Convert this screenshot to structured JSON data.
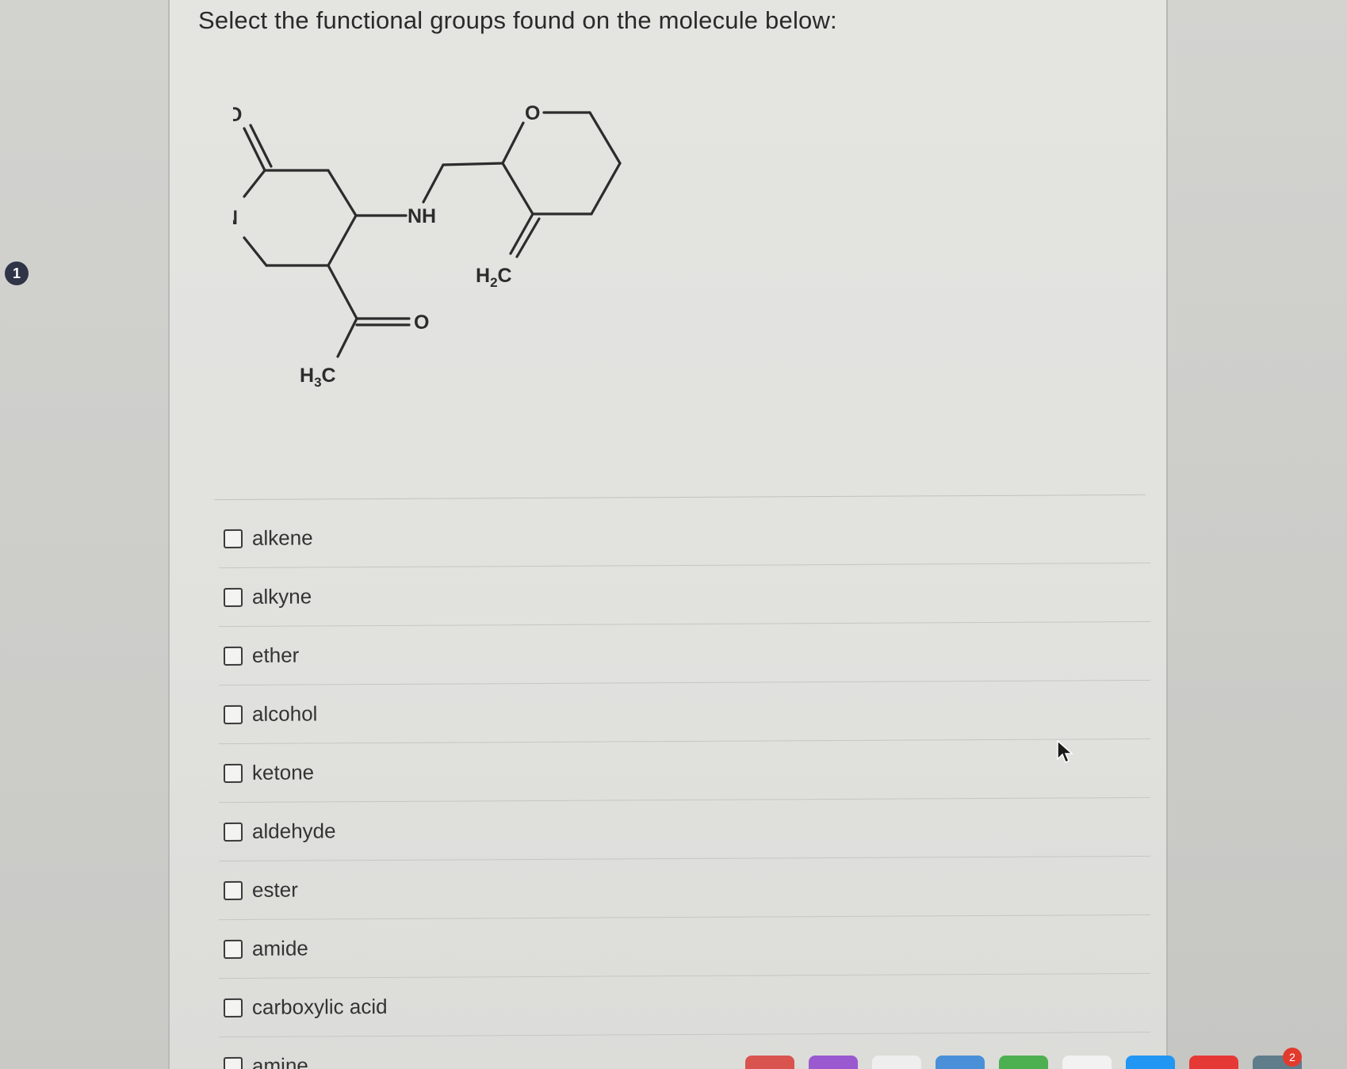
{
  "question": {
    "number": "1",
    "prompt": "Select the functional groups found on the molecule below:"
  },
  "molecule": {
    "labels": {
      "o_lactam": "O",
      "hn": "HN",
      "nh": "NH",
      "o_ring": "O",
      "o_ketone": "O",
      "h3c": "H3C",
      "h2c": "H2C"
    }
  },
  "options": [
    {
      "label": "alkene",
      "checked": false
    },
    {
      "label": "alkyne",
      "checked": false
    },
    {
      "label": "ether",
      "checked": false
    },
    {
      "label": "alcohol",
      "checked": false
    },
    {
      "label": "ketone",
      "checked": false
    },
    {
      "label": "aldehyde",
      "checked": false
    },
    {
      "label": "ester",
      "checked": false
    },
    {
      "label": "amide",
      "checked": false
    },
    {
      "label": "carboxylic acid",
      "checked": false
    },
    {
      "label": "amine",
      "checked": false
    }
  ],
  "dock": {
    "notification_count": "2",
    "colors": [
      "#d9534f",
      "#9b59d0",
      "#eeeeee",
      "#4a90d9",
      "#4caf50",
      "#f2f2f2",
      "#2196f3",
      "#e53935",
      "#607d8b"
    ]
  }
}
